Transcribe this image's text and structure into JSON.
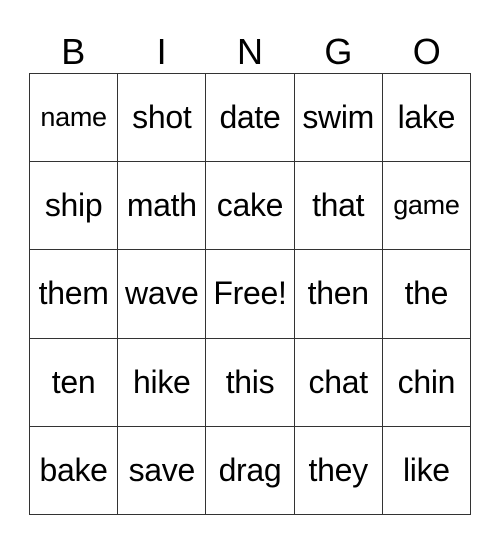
{
  "card": {
    "header": [
      "B",
      "I",
      "N",
      "G",
      "O"
    ],
    "rows": [
      [
        "name",
        "shot",
        "date",
        "swim",
        "lake"
      ],
      [
        "ship",
        "math",
        "cake",
        "that",
        "game"
      ],
      [
        "them",
        "wave",
        "Free!",
        "then",
        "the"
      ],
      [
        "ten",
        "hike",
        "this",
        "chat",
        "chin"
      ],
      [
        "bake",
        "save",
        "drag",
        "they",
        "like"
      ]
    ],
    "free_space": "Free!"
  }
}
